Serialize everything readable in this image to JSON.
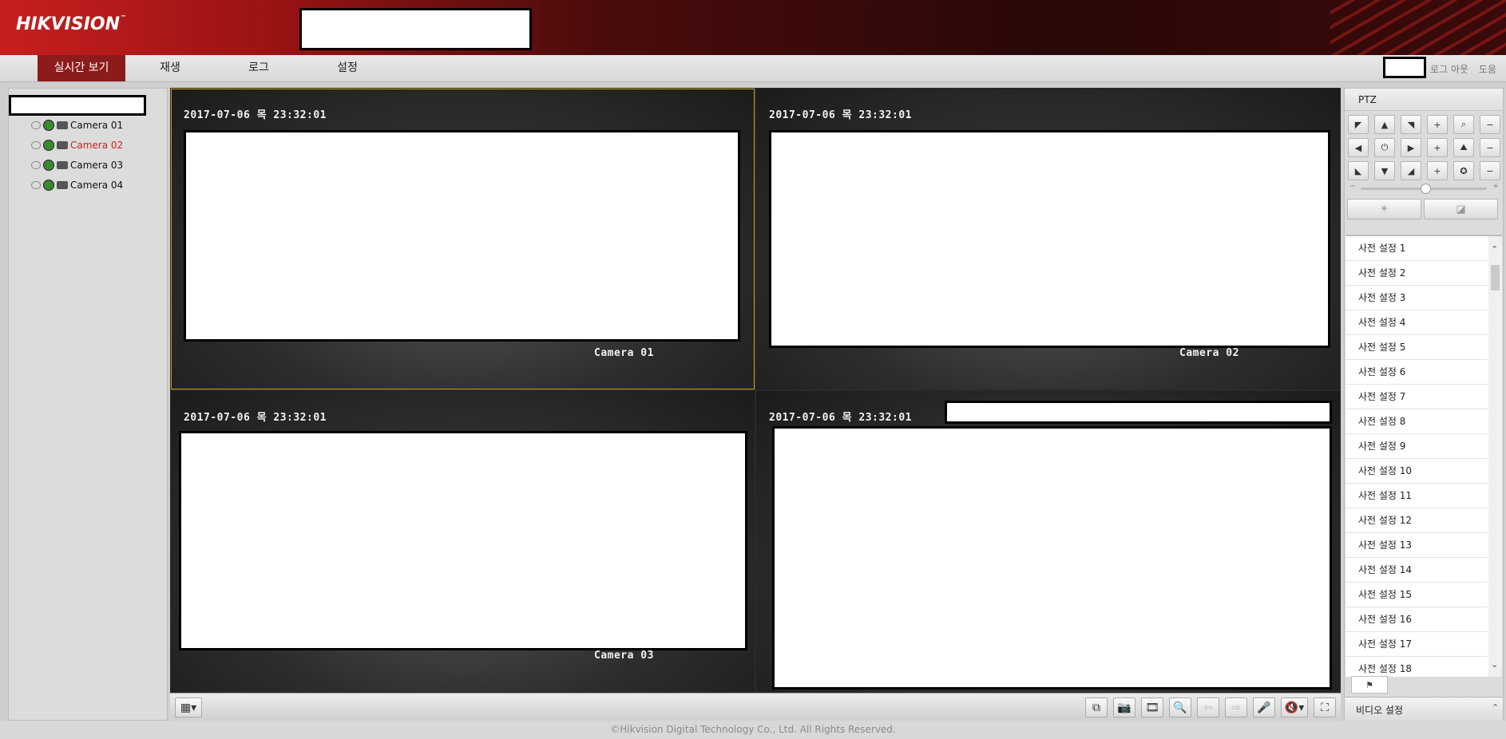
{
  "header": {
    "logo_text": "HIKVISION",
    "logo_tm": "™",
    "brand_color": "#c71f1f"
  },
  "nav": {
    "tabs": [
      {
        "label": "실시간 보기",
        "active": true
      },
      {
        "label": "재생",
        "active": false
      },
      {
        "label": "로그",
        "active": false
      },
      {
        "label": "설정",
        "active": false
      }
    ],
    "logout_label": "로그 아웃",
    "help_label": "도움"
  },
  "cameras": [
    {
      "label": "Camera 01",
      "active": false
    },
    {
      "label": "Camera 02",
      "active": true
    },
    {
      "label": "Camera 03",
      "active": false
    },
    {
      "label": "Camera 04",
      "active": false
    }
  ],
  "video": {
    "tiles": [
      {
        "timestamp": "2017-07-06 목 23:32:01",
        "caption": "Camera 01",
        "selected": true
      },
      {
        "timestamp": "2017-07-06 목 23:32:01",
        "caption": "Camera 02",
        "selected": false
      },
      {
        "timestamp": "2017-07-06 목 23:32:01",
        "caption": "Camera 03",
        "selected": false
      },
      {
        "timestamp": "2017-07-06 목 23:32:01",
        "caption": "",
        "selected": false
      }
    ],
    "selection_color": "#c9a020"
  },
  "ptz": {
    "title": "PTZ",
    "presets": [
      "사전 설정 1",
      "사전 설정 2",
      "사전 설정 3",
      "사전 설정 4",
      "사전 설정 5",
      "사전 설정 6",
      "사전 설정 7",
      "사전 설정 8",
      "사전 설정 9",
      "사전 설정 10",
      "사전 설정 11",
      "사전 설정 12",
      "사전 설정 13",
      "사전 설정 14",
      "사전 설정 15",
      "사전 설정 16",
      "사전 설정 17",
      "사전 설정 18"
    ],
    "slider_minus": "−",
    "slider_plus": "+"
  },
  "video_settings_label": "비디오 설정",
  "footer": "©Hikvision Digital Technology Co., Ltd. All Rights Reserved."
}
